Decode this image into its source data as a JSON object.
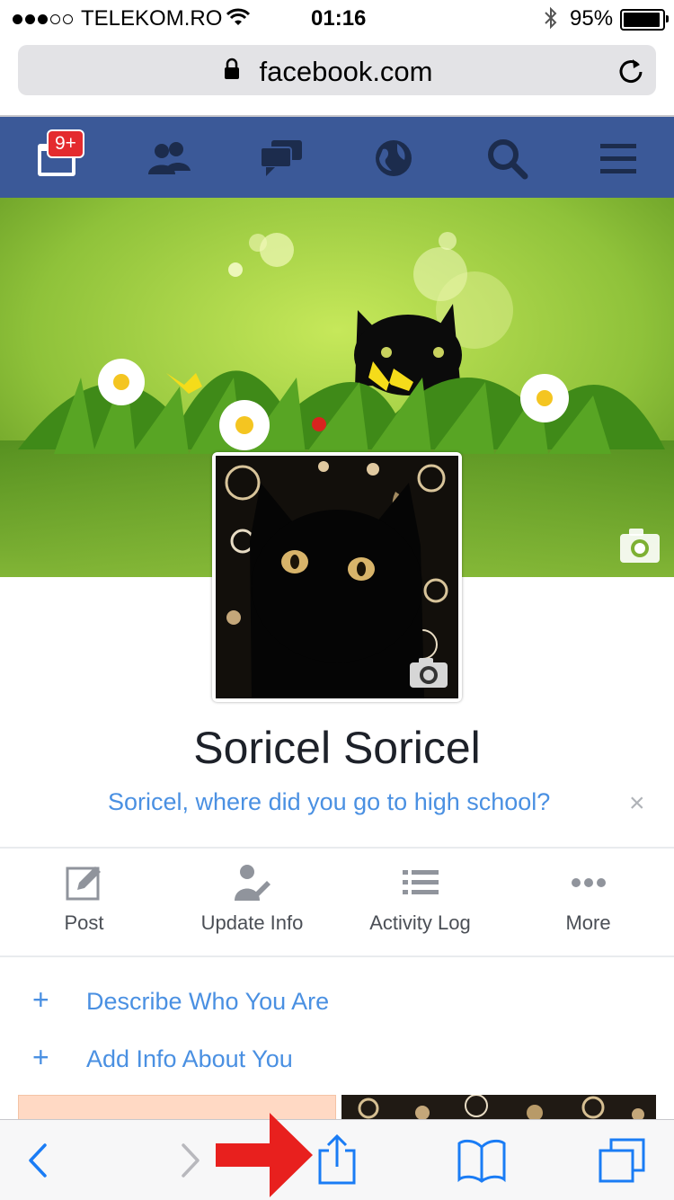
{
  "status_bar": {
    "carrier": "TELEKOM.RO",
    "time": "01:16",
    "battery": "95%"
  },
  "browser": {
    "url": "facebook.com"
  },
  "fb_nav": {
    "notification_badge": "9+",
    "icons": [
      "news-feed-icon",
      "friends-icon",
      "messages-icon",
      "globe-icon",
      "search-icon",
      "menu-icon"
    ]
  },
  "profile": {
    "name": "Soricel Soricel",
    "prompt": "Soricel, where did you go to high school?",
    "prompt_close": "×"
  },
  "actions": [
    {
      "label": "Post",
      "icon": "edit-icon"
    },
    {
      "label": "Update Info",
      "icon": "person-edit-icon"
    },
    {
      "label": "Activity Log",
      "icon": "list-icon"
    },
    {
      "label": "More",
      "icon": "more-icon"
    }
  ],
  "add_links": [
    {
      "plus": "+",
      "label": "Describe Who You Are"
    },
    {
      "plus": "+",
      "label": "Add Info About You"
    }
  ],
  "colors": {
    "facebook_blue": "#3b5998",
    "link_blue": "#4a90e2",
    "safari_blue": "#1a7cf5",
    "badge_red": "#e42b2e",
    "arrow_red": "#e8201e"
  }
}
